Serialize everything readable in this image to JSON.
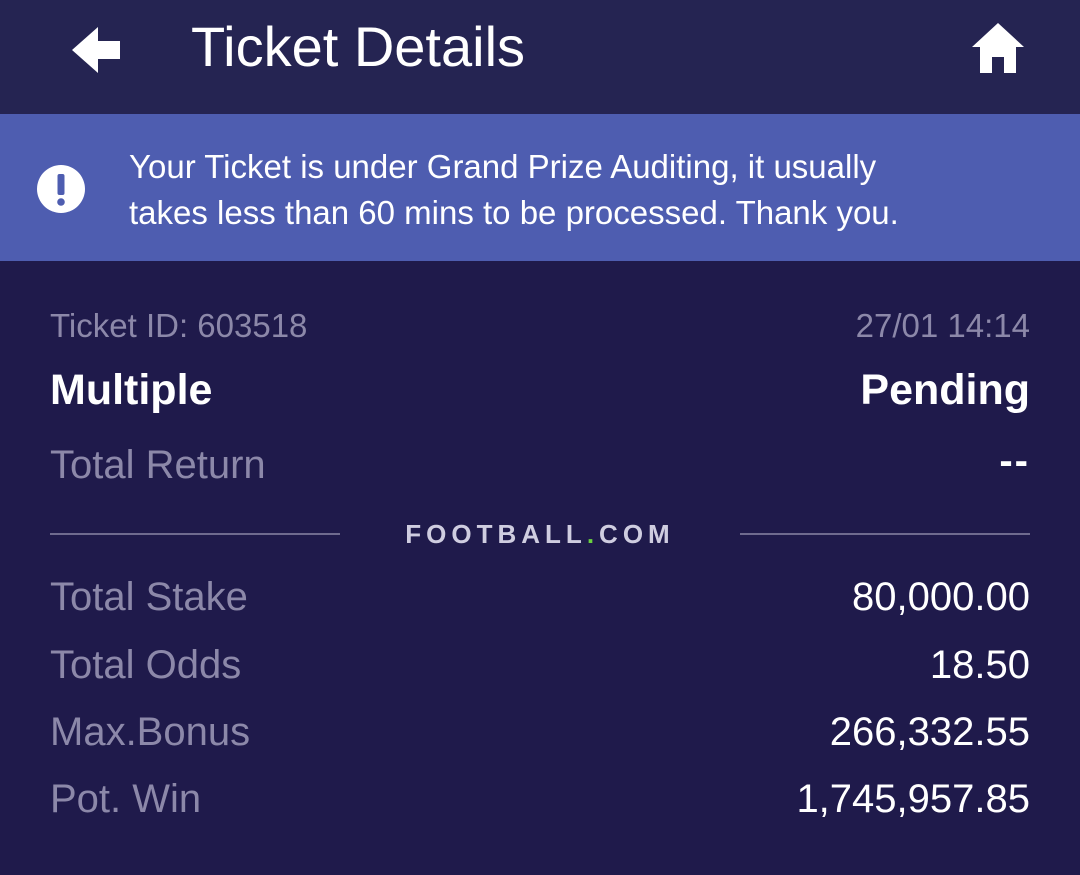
{
  "header": {
    "title": "Ticket Details",
    "back_icon": "arrow-left-icon",
    "home_icon": "home-icon"
  },
  "notice": {
    "icon": "alert-circle-icon",
    "line1": "Your Ticket is under Grand Prize Auditing, it usually",
    "line2": "takes less than 60 mins to be processed. Thank you."
  },
  "ticket": {
    "id_label": "Ticket ID: 603518",
    "datetime": "27/01 14:14",
    "type": "Multiple",
    "status": "Pending",
    "total_return_label": "Total Return",
    "total_return_value": "--"
  },
  "brand": {
    "left_text": "FOOTBALL",
    "dot": ".",
    "right_text": "COM"
  },
  "amounts": {
    "stake_label": "Total Stake",
    "stake_value": "80,000.00",
    "odds_label": "Total Odds",
    "odds_value": "18.50",
    "bonus_label": "Max.Bonus",
    "bonus_value": "266,332.55",
    "win_label": "Pot. Win",
    "win_value": "1,745,957.85"
  },
  "colors": {
    "background": "#1f1a4b",
    "header": "#252452",
    "notice": "#4e5db0",
    "muted_text": "#8c88a9",
    "brand_dot": "#6ad13f"
  }
}
